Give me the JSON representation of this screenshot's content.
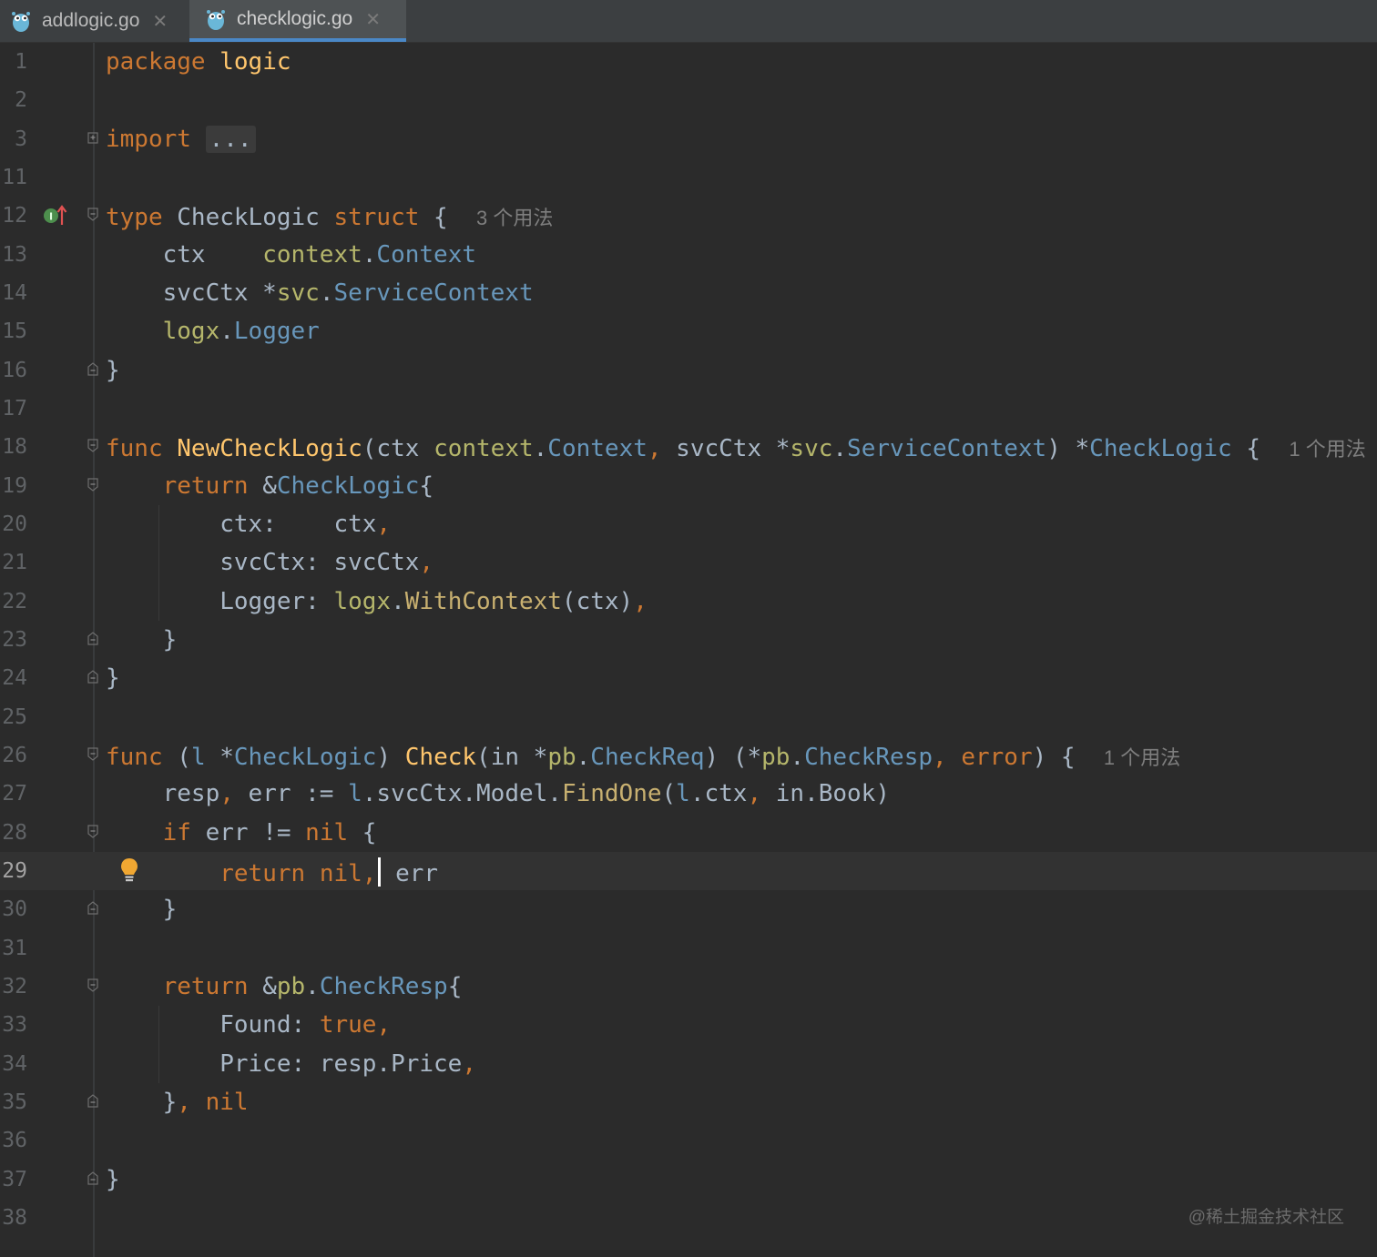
{
  "tabs": [
    {
      "label": "addlogic.go",
      "close": "✕",
      "active": false
    },
    {
      "label": "checklogic.go",
      "close": "✕",
      "active": true
    }
  ],
  "icons": {
    "gopher": "gopher-icon",
    "fold": "fold-toggle-icon",
    "implemented": "implemented-interface-icon",
    "bulb": "intention-bulb-icon"
  },
  "colors": {
    "background": "#2b2b2b",
    "keyword": "#cc7832",
    "function": "#ffc66d",
    "type": "#6897bb",
    "active_tab_underline": "#4a88c7"
  },
  "current_line": "29",
  "lines": {
    "l1": {
      "num": "1",
      "t": [
        [
          "package",
          "kw"
        ],
        [
          " ",
          ""
        ],
        [
          "logic",
          "fn"
        ]
      ]
    },
    "l2": {
      "num": "2",
      "t": []
    },
    "l3": {
      "num": "3",
      "t": [
        [
          "import",
          "kw"
        ],
        [
          " ",
          ""
        ],
        [
          "...",
          "collapsed"
        ]
      ]
    },
    "l11": {
      "num": "11",
      "t": []
    },
    "l12": {
      "num": "12",
      "t": [
        [
          "type",
          "kw"
        ],
        [
          " CheckLogic ",
          ""
        ],
        [
          "struct",
          "kw"
        ],
        [
          " {  ",
          ""
        ],
        [
          "3 个用法",
          "hint"
        ]
      ]
    },
    "l13": {
      "num": "13",
      "t": [
        [
          "    ctx    ",
          ""
        ],
        [
          "context",
          "pk"
        ],
        [
          ".",
          ""
        ],
        [
          "Context",
          "tp"
        ]
      ]
    },
    "l14": {
      "num": "14",
      "t": [
        [
          "    svcCtx *",
          ""
        ],
        [
          "svc",
          "pk"
        ],
        [
          ".",
          ""
        ],
        [
          "ServiceContext",
          "tp"
        ]
      ]
    },
    "l15": {
      "num": "15",
      "t": [
        [
          "    ",
          ""
        ],
        [
          "logx",
          "pk"
        ],
        [
          ".",
          ""
        ],
        [
          "Logger",
          "tp"
        ]
      ]
    },
    "l16": {
      "num": "16",
      "t": [
        [
          "}",
          ""
        ]
      ]
    },
    "l17": {
      "num": "17",
      "t": []
    },
    "l18": {
      "num": "18",
      "t": [
        [
          "func",
          "kw"
        ],
        [
          " ",
          ""
        ],
        [
          "NewCheckLogic",
          "fn"
        ],
        [
          "(ctx ",
          ""
        ],
        [
          "context",
          "pk"
        ],
        [
          ".",
          ""
        ],
        [
          "Context",
          "tp"
        ],
        [
          ",",
          "kw"
        ],
        [
          " svcCtx *",
          ""
        ],
        [
          "svc",
          "pk"
        ],
        [
          ".",
          ""
        ],
        [
          "ServiceContext",
          "tp"
        ],
        [
          ") *",
          ""
        ],
        [
          "CheckLogic",
          "tp"
        ],
        [
          " {  ",
          ""
        ],
        [
          "1 个用法",
          "hint"
        ]
      ]
    },
    "l19": {
      "num": "19",
      "t": [
        [
          "    ",
          ""
        ],
        [
          "return",
          "kw"
        ],
        [
          " &",
          ""
        ],
        [
          "CheckLogic",
          "tp"
        ],
        [
          "{",
          ""
        ]
      ]
    },
    "l20": {
      "num": "20",
      "t": [
        [
          "        ctx:    ctx",
          ""
        ],
        [
          ",",
          "kw"
        ]
      ]
    },
    "l21": {
      "num": "21",
      "t": [
        [
          "        svcCtx: svcCtx",
          ""
        ],
        [
          ",",
          "kw"
        ]
      ]
    },
    "l22": {
      "num": "22",
      "t": [
        [
          "        Logger: ",
          ""
        ],
        [
          "logx",
          "pk"
        ],
        [
          ".",
          ""
        ],
        [
          "WithContext",
          "call"
        ],
        [
          "(ctx)",
          ""
        ],
        [
          ",",
          "kw"
        ]
      ]
    },
    "l23": {
      "num": "23",
      "t": [
        [
          "    }",
          ""
        ]
      ]
    },
    "l24": {
      "num": "24",
      "t": [
        [
          "}",
          ""
        ]
      ]
    },
    "l25": {
      "num": "25",
      "t": []
    },
    "l26": {
      "num": "26",
      "t": [
        [
          "func",
          "kw"
        ],
        [
          " (",
          ""
        ],
        [
          "l",
          "tp"
        ],
        [
          " *",
          ""
        ],
        [
          "CheckLogic",
          "tp"
        ],
        [
          ") ",
          ""
        ],
        [
          "Check",
          "fn"
        ],
        [
          "(in *",
          ""
        ],
        [
          "pb",
          "pk"
        ],
        [
          ".",
          ""
        ],
        [
          "CheckReq",
          "tp"
        ],
        [
          ") (*",
          ""
        ],
        [
          "pb",
          "pk"
        ],
        [
          ".",
          ""
        ],
        [
          "CheckResp",
          "tp"
        ],
        [
          ",",
          "kw"
        ],
        [
          " ",
          ""
        ],
        [
          "error",
          "kw"
        ],
        [
          ") {  ",
          ""
        ],
        [
          "1 个用法",
          "hint"
        ]
      ]
    },
    "l27": {
      "num": "27",
      "t": [
        [
          "    resp",
          ""
        ],
        [
          ",",
          "kw"
        ],
        [
          " err := ",
          ""
        ],
        [
          "l",
          "tp"
        ],
        [
          ".svcCtx.Model.",
          ""
        ],
        [
          "FindOne",
          "call"
        ],
        [
          "(",
          ""
        ],
        [
          "l",
          "tp"
        ],
        [
          ".ctx",
          ""
        ],
        [
          ",",
          "kw"
        ],
        [
          " in.Book)",
          ""
        ]
      ]
    },
    "l28": {
      "num": "28",
      "t": [
        [
          "    ",
          ""
        ],
        [
          "if",
          "kw"
        ],
        [
          " err != ",
          ""
        ],
        [
          "nil",
          "kw"
        ],
        [
          " {",
          ""
        ]
      ]
    },
    "l29": {
      "num": "29",
      "t": [
        [
          "        ",
          ""
        ],
        [
          "return",
          "kw"
        ],
        [
          " ",
          ""
        ],
        [
          "nil",
          "kw"
        ],
        [
          ",",
          "kw"
        ],
        [
          "CARET",
          "caret"
        ],
        [
          " err",
          ""
        ]
      ]
    },
    "l30": {
      "num": "30",
      "t": [
        [
          "    }",
          ""
        ]
      ]
    },
    "l31": {
      "num": "31",
      "t": []
    },
    "l32": {
      "num": "32",
      "t": [
        [
          "    ",
          ""
        ],
        [
          "return",
          "kw"
        ],
        [
          " &",
          ""
        ],
        [
          "pb",
          "pk"
        ],
        [
          ".",
          ""
        ],
        [
          "CheckResp",
          "tp"
        ],
        [
          "{",
          ""
        ]
      ]
    },
    "l33": {
      "num": "33",
      "t": [
        [
          "        Found: ",
          ""
        ],
        [
          "true",
          "kw"
        ],
        [
          ",",
          "kw"
        ]
      ]
    },
    "l34": {
      "num": "34",
      "t": [
        [
          "        Price: resp.Price",
          ""
        ],
        [
          ",",
          "kw"
        ]
      ]
    },
    "l35": {
      "num": "35",
      "t": [
        [
          "    }",
          ""
        ],
        [
          ",",
          "kw"
        ],
        [
          " ",
          ""
        ],
        [
          "nil",
          "kw"
        ]
      ]
    },
    "l36": {
      "num": "36",
      "t": []
    },
    "l37": {
      "num": "37",
      "t": [
        [
          "}",
          ""
        ]
      ]
    },
    "l38": {
      "num": "38",
      "t": []
    }
  },
  "watermark": "@稀土掘金技术社区"
}
